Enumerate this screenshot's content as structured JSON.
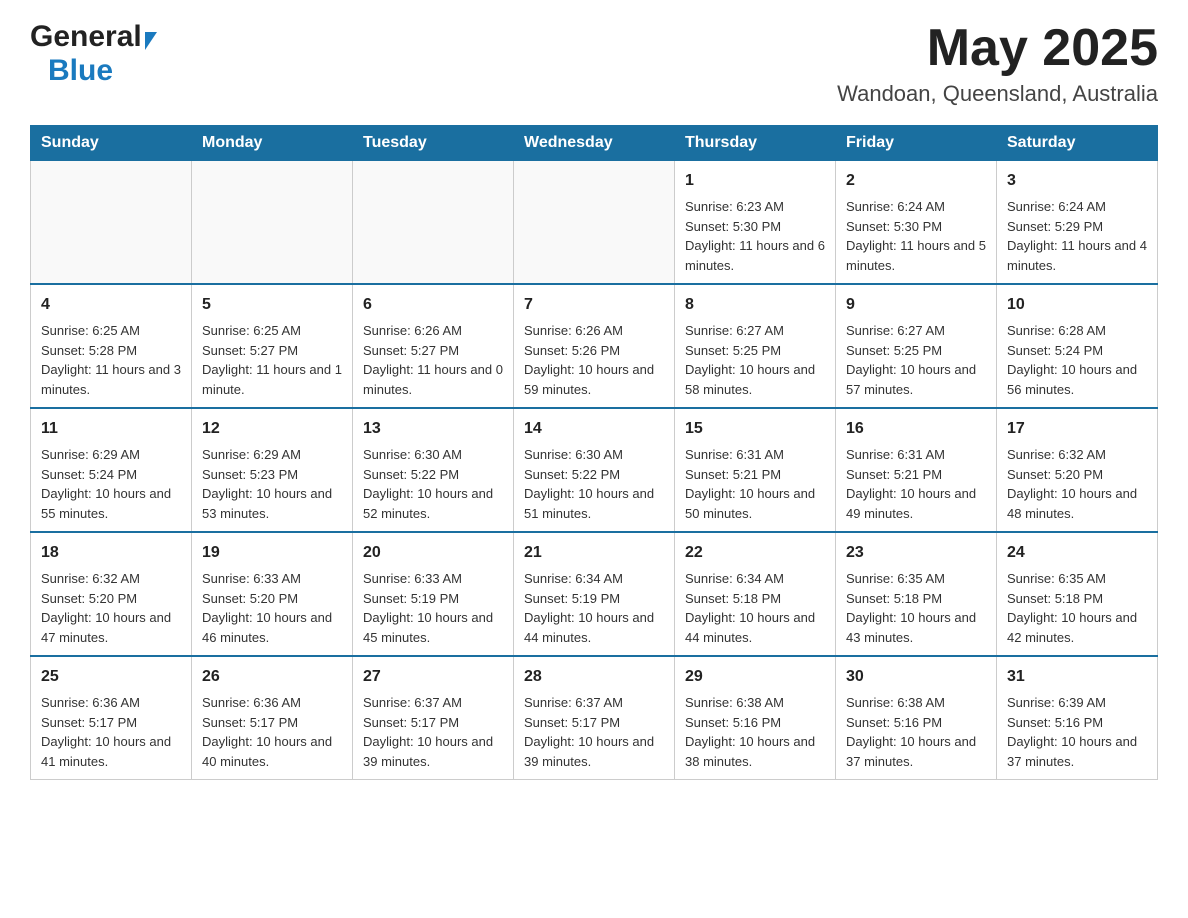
{
  "header": {
    "logo_line1": "General",
    "logo_line2": "Blue",
    "month_year": "May 2025",
    "location": "Wandoan, Queensland, Australia"
  },
  "calendar": {
    "days_of_week": [
      "Sunday",
      "Monday",
      "Tuesday",
      "Wednesday",
      "Thursday",
      "Friday",
      "Saturday"
    ],
    "weeks": [
      [
        {
          "day": "",
          "info": ""
        },
        {
          "day": "",
          "info": ""
        },
        {
          "day": "",
          "info": ""
        },
        {
          "day": "",
          "info": ""
        },
        {
          "day": "1",
          "info": "Sunrise: 6:23 AM\nSunset: 5:30 PM\nDaylight: 11 hours and 6 minutes."
        },
        {
          "day": "2",
          "info": "Sunrise: 6:24 AM\nSunset: 5:30 PM\nDaylight: 11 hours and 5 minutes."
        },
        {
          "day": "3",
          "info": "Sunrise: 6:24 AM\nSunset: 5:29 PM\nDaylight: 11 hours and 4 minutes."
        }
      ],
      [
        {
          "day": "4",
          "info": "Sunrise: 6:25 AM\nSunset: 5:28 PM\nDaylight: 11 hours and 3 minutes."
        },
        {
          "day": "5",
          "info": "Sunrise: 6:25 AM\nSunset: 5:27 PM\nDaylight: 11 hours and 1 minute."
        },
        {
          "day": "6",
          "info": "Sunrise: 6:26 AM\nSunset: 5:27 PM\nDaylight: 11 hours and 0 minutes."
        },
        {
          "day": "7",
          "info": "Sunrise: 6:26 AM\nSunset: 5:26 PM\nDaylight: 10 hours and 59 minutes."
        },
        {
          "day": "8",
          "info": "Sunrise: 6:27 AM\nSunset: 5:25 PM\nDaylight: 10 hours and 58 minutes."
        },
        {
          "day": "9",
          "info": "Sunrise: 6:27 AM\nSunset: 5:25 PM\nDaylight: 10 hours and 57 minutes."
        },
        {
          "day": "10",
          "info": "Sunrise: 6:28 AM\nSunset: 5:24 PM\nDaylight: 10 hours and 56 minutes."
        }
      ],
      [
        {
          "day": "11",
          "info": "Sunrise: 6:29 AM\nSunset: 5:24 PM\nDaylight: 10 hours and 55 minutes."
        },
        {
          "day": "12",
          "info": "Sunrise: 6:29 AM\nSunset: 5:23 PM\nDaylight: 10 hours and 53 minutes."
        },
        {
          "day": "13",
          "info": "Sunrise: 6:30 AM\nSunset: 5:22 PM\nDaylight: 10 hours and 52 minutes."
        },
        {
          "day": "14",
          "info": "Sunrise: 6:30 AM\nSunset: 5:22 PM\nDaylight: 10 hours and 51 minutes."
        },
        {
          "day": "15",
          "info": "Sunrise: 6:31 AM\nSunset: 5:21 PM\nDaylight: 10 hours and 50 minutes."
        },
        {
          "day": "16",
          "info": "Sunrise: 6:31 AM\nSunset: 5:21 PM\nDaylight: 10 hours and 49 minutes."
        },
        {
          "day": "17",
          "info": "Sunrise: 6:32 AM\nSunset: 5:20 PM\nDaylight: 10 hours and 48 minutes."
        }
      ],
      [
        {
          "day": "18",
          "info": "Sunrise: 6:32 AM\nSunset: 5:20 PM\nDaylight: 10 hours and 47 minutes."
        },
        {
          "day": "19",
          "info": "Sunrise: 6:33 AM\nSunset: 5:20 PM\nDaylight: 10 hours and 46 minutes."
        },
        {
          "day": "20",
          "info": "Sunrise: 6:33 AM\nSunset: 5:19 PM\nDaylight: 10 hours and 45 minutes."
        },
        {
          "day": "21",
          "info": "Sunrise: 6:34 AM\nSunset: 5:19 PM\nDaylight: 10 hours and 44 minutes."
        },
        {
          "day": "22",
          "info": "Sunrise: 6:34 AM\nSunset: 5:18 PM\nDaylight: 10 hours and 44 minutes."
        },
        {
          "day": "23",
          "info": "Sunrise: 6:35 AM\nSunset: 5:18 PM\nDaylight: 10 hours and 43 minutes."
        },
        {
          "day": "24",
          "info": "Sunrise: 6:35 AM\nSunset: 5:18 PM\nDaylight: 10 hours and 42 minutes."
        }
      ],
      [
        {
          "day": "25",
          "info": "Sunrise: 6:36 AM\nSunset: 5:17 PM\nDaylight: 10 hours and 41 minutes."
        },
        {
          "day": "26",
          "info": "Sunrise: 6:36 AM\nSunset: 5:17 PM\nDaylight: 10 hours and 40 minutes."
        },
        {
          "day": "27",
          "info": "Sunrise: 6:37 AM\nSunset: 5:17 PM\nDaylight: 10 hours and 39 minutes."
        },
        {
          "day": "28",
          "info": "Sunrise: 6:37 AM\nSunset: 5:17 PM\nDaylight: 10 hours and 39 minutes."
        },
        {
          "day": "29",
          "info": "Sunrise: 6:38 AM\nSunset: 5:16 PM\nDaylight: 10 hours and 38 minutes."
        },
        {
          "day": "30",
          "info": "Sunrise: 6:38 AM\nSunset: 5:16 PM\nDaylight: 10 hours and 37 minutes."
        },
        {
          "day": "31",
          "info": "Sunrise: 6:39 AM\nSunset: 5:16 PM\nDaylight: 10 hours and 37 minutes."
        }
      ]
    ]
  }
}
